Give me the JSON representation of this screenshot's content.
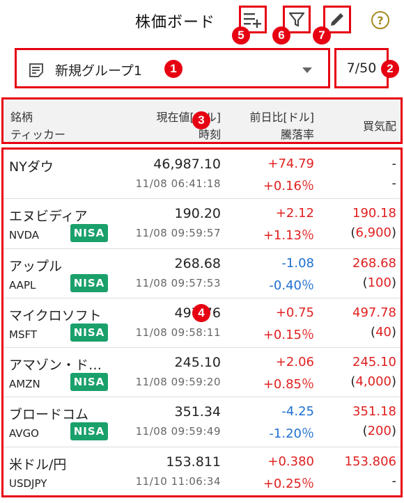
{
  "header": {
    "title": "株価ボード"
  },
  "group": {
    "name": "新規グループ1",
    "count": "7/50"
  },
  "badges": [
    "1",
    "2",
    "3",
    "4",
    "5",
    "6",
    "7"
  ],
  "columns": {
    "name": "銘柄",
    "ticker": "ティッカー",
    "price": "現在値[ドル]",
    "time": "時刻",
    "change": "前日比[ドル]",
    "pct": "騰落率",
    "bid": "買気配"
  },
  "colors": {
    "accent": "#e60012",
    "up": "#e02020",
    "down": "#1e6fd0",
    "nisa": "#1aa06b",
    "help": "#a48a22"
  },
  "rows": [
    {
      "name": "NYダウ",
      "ticker": "",
      "nisa": "",
      "price": "46,987.10",
      "time": "11/08 06:41:18",
      "change": "+74.79",
      "pct": "+0.16％",
      "dir": "up",
      "bid": "-",
      "qty_open": "",
      "qty": "-",
      "qty_close": ""
    },
    {
      "name": "エヌビディア",
      "ticker": "NVDA",
      "nisa": "NISA",
      "price": "190.20",
      "time": "11/08 09:59:57",
      "change": "+2.12",
      "pct": "+1.13％",
      "dir": "up",
      "bid": "190.18",
      "qty_open": "(",
      "qty": "6,900",
      "qty_close": ")"
    },
    {
      "name": "アップル",
      "ticker": "AAPL",
      "nisa": "NISA",
      "price": "268.68",
      "time": "11/08 09:57:53",
      "change": "-1.08",
      "pct": "-0.40％",
      "dir": "down",
      "bid": "268.68",
      "qty_open": "(",
      "qty": "100",
      "qty_close": ")"
    },
    {
      "name": "マイクロソフト",
      "ticker": "MSFT",
      "nisa": "NISA",
      "price": "497.76",
      "time": "11/08 09:58:11",
      "change": "+0.75",
      "pct": "+0.15％",
      "dir": "up",
      "bid": "497.78",
      "qty_open": "(",
      "qty": "40",
      "qty_close": ")"
    },
    {
      "name": "アマゾン・ド…",
      "ticker": "AMZN",
      "nisa": "NISA",
      "price": "245.10",
      "time": "11/08 09:59:20",
      "change": "+2.06",
      "pct": "+0.85％",
      "dir": "up",
      "bid": "245.10",
      "qty_open": "(",
      "qty": "4,000",
      "qty_close": ")"
    },
    {
      "name": "ブロードコム",
      "ticker": "AVGO",
      "nisa": "NISA",
      "price": "351.34",
      "time": "11/08 09:59:49",
      "change": "-4.25",
      "pct": "-1.20％",
      "dir": "down",
      "bid": "351.18",
      "qty_open": "(",
      "qty": "200",
      "qty_close": ")"
    },
    {
      "name": "米ドル/円",
      "ticker": "USDJPY",
      "nisa": "",
      "price": "153.811",
      "time": "11/10 11:06:34",
      "change": "+0.380",
      "pct": "+0.25％",
      "dir": "up",
      "bid": "153.806",
      "qty_open": "",
      "qty": "-",
      "qty_close": ""
    }
  ]
}
